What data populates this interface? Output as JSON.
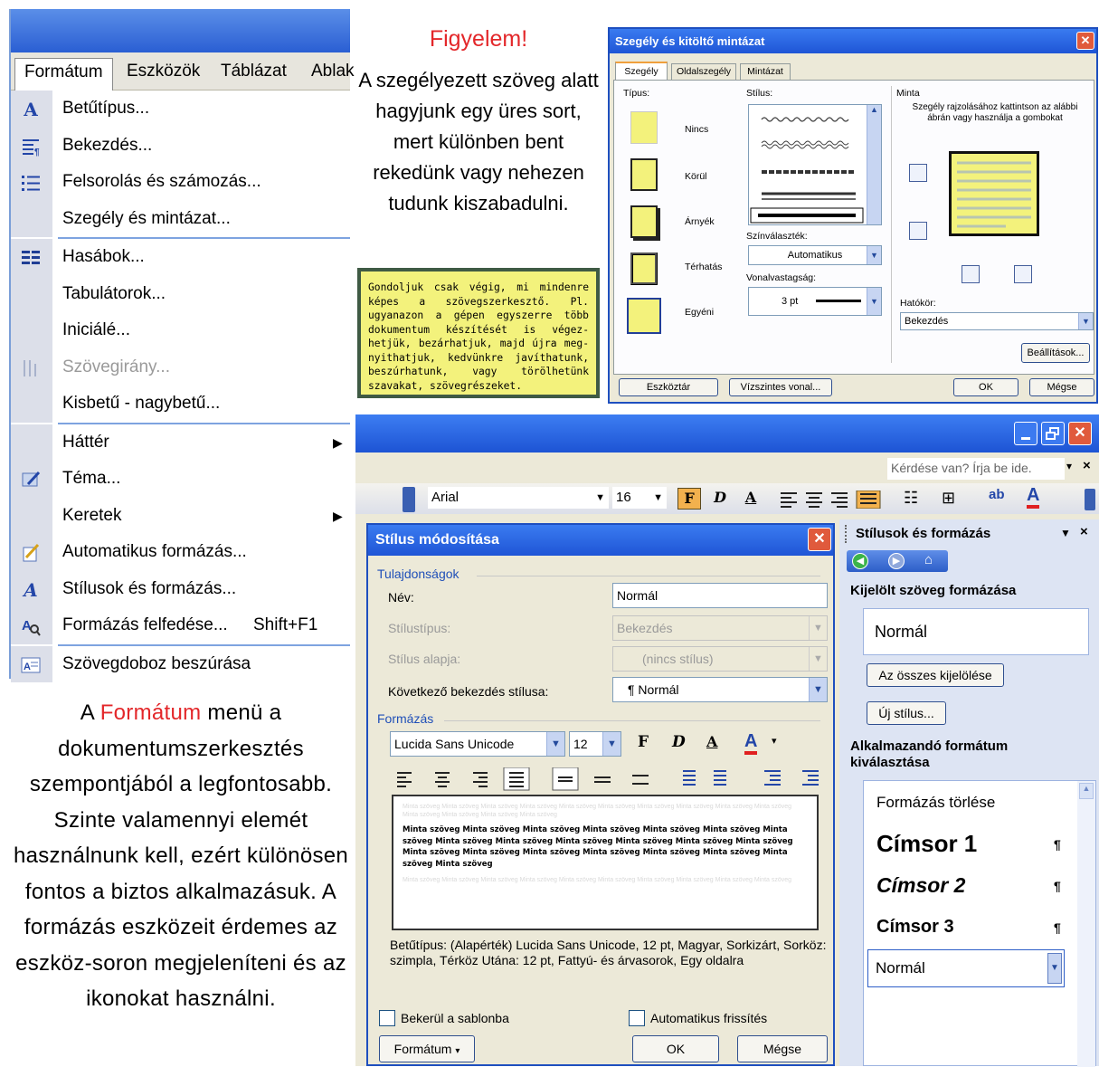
{
  "menubar": {
    "items": [
      "Formátum",
      "Eszközök",
      "Táblázat",
      "Ablak"
    ]
  },
  "format_menu": {
    "items": [
      {
        "label": "Betűtípus...",
        "icon": "font-icon"
      },
      {
        "label": "Bekezdés...",
        "icon": "paragraph-icon"
      },
      {
        "label": "Felsorolás és számozás...",
        "icon": "bullets-icon"
      },
      {
        "label": "Szegély és mintázat...",
        "icon": ""
      },
      {
        "label": "Hasábok...",
        "icon": "columns-icon"
      },
      {
        "label": "Tabulátorok...",
        "icon": ""
      },
      {
        "label": "Iniciálé...",
        "icon": ""
      },
      {
        "label": "Szövegirány...",
        "icon": "text-direction-icon",
        "disabled": true
      },
      {
        "label": "Kisbetű - nagybetű...",
        "icon": ""
      },
      {
        "label": "Háttér",
        "icon": "",
        "submenu": true
      },
      {
        "label": "Téma...",
        "icon": "theme-icon"
      },
      {
        "label": "Keretek",
        "icon": "",
        "submenu": true
      },
      {
        "label": "Automatikus formázás...",
        "icon": "autoformat-icon"
      },
      {
        "label": "Stílusok és formázás...",
        "icon": "styles-icon"
      },
      {
        "label": "Formázás felfedése...",
        "shortcut": "Shift+F1",
        "icon": "reveal-formatting-icon"
      },
      {
        "label": "Szövegdoboz beszúrása",
        "icon": "textbox-icon"
      }
    ]
  },
  "caption": {
    "before": "A ",
    "highlight": "Formátum",
    "after": " menü  a dokumentumszerkesztés szempontjából a legfontosabb. Szinte valamennyi elemét használnunk kell, ezért különösen fontos a biztos alkalmazásuk. A formázás eszközeit érdemes az eszköz-soron megjeleníteni és az ikonokat használni.",
    "highlight_color": "#e3272a"
  },
  "notice": {
    "title": "Figyelem!",
    "text": "A szegélyezett szöveg alatt hagyjunk egy üres sort, mert különben bent rekedünk vagy nehezen tudunk kiszabadulni.",
    "title_color": "#e3272a"
  },
  "yellow_box": {
    "text": "Gondoljuk csak végig, mi mindenre képes a szövegszerkesztő. Pl. ugyanazon a gépen egyszerre több dokumentum készítését is végez-hetjük, bezárhatjuk, majd újra meg-nyithatjuk, kedvünkre javíthatunk, beszúrhatunk, vagy törölhetünk szavakat, szövegrészeket.",
    "bg": "#f3f27c"
  },
  "border_dialog": {
    "title": "Szegély és kitöltő mintázat",
    "tabs": [
      "Szegély",
      "Oldalszegély",
      "Mintázat"
    ],
    "type_label": "Típus:",
    "types": [
      "Nincs",
      "Körül",
      "Árnyék",
      "Térhatás",
      "Egyéni"
    ],
    "style_label": "Stílus:",
    "color_label": "Színválaszték:",
    "color_value": "Automatikus",
    "width_label": "Vonalvastagság:",
    "width_value": "3 pt",
    "preview_label": "Minta",
    "preview_hint": "Szegély rajzolásához kattintson az alábbi ábrán vagy használja a gombokat",
    "apply_label": "Hatókör:",
    "apply_value": "Bekezdés",
    "options_button": "Beállítások...",
    "toolbar_button": "Eszköztár",
    "hline_button": "Vízszintes vonal...",
    "ok": "OK",
    "cancel": "Mégse"
  },
  "word": {
    "ask_placeholder": "Kérdése van? Írja be ide.",
    "font": "Arial",
    "size": "16",
    "bold_glyph": "F",
    "italic_glyph": "D",
    "underline_glyph": "A"
  },
  "style_dialog": {
    "title": "Stílus módosítása",
    "properties_group": "Tulajdonságok",
    "name_label": "Név:",
    "name_value": "Normál",
    "type_label": "Stílustípus:",
    "type_value": "Bekezdés",
    "based_label": "Stílus alapja:",
    "based_value": "(nincs stílus)",
    "next_label": "Következő bekezdés stílusa:",
    "next_value": "¶ Normál",
    "format_group": "Formázás",
    "font_value": "Lucida Sans Unicode",
    "size_value": "12",
    "bold_glyph": "F",
    "italic_glyph": "D",
    "underline_glyph": "A",
    "sample_word": "Minta szöveg",
    "description": "Betűtípus: (Alapérték) Lucida Sans Unicode, 12 pt, Magyar, Sorkizárt, Sorköz:  szimpla, Térköz Utána:  12 pt, Fattyú- és árvasorok, Egy oldalra",
    "template_checkbox": "Bekerül a sablonba",
    "autoupdate_checkbox": "Automatikus frissítés",
    "format_button": "Formátum",
    "ok": "OK",
    "cancel": "Mégse"
  },
  "task_pane": {
    "title": "Stílusok és formázás",
    "selected_heading": "Kijelölt szöveg formázása",
    "selected_value": "Normál",
    "select_all_button": "Az összes kijelölése",
    "new_style_button": "Új stílus...",
    "apply_heading": "Alkalmazandó formátum kiválasztása",
    "styles": [
      "Formázás törlése",
      "Címsor 1",
      "Címsor 2",
      "Címsor 3",
      "Normál"
    ],
    "pilcrow": "¶"
  }
}
